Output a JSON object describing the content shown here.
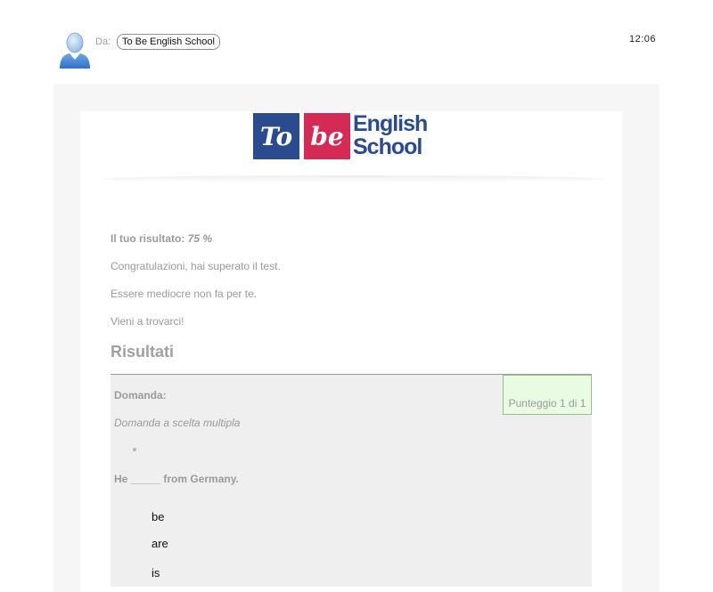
{
  "header": {
    "from_label": "Da:",
    "sender": "To Be English School",
    "time": "12:06",
    "avatar_icon": "user-avatar-icon"
  },
  "logo": {
    "box1": "To",
    "box2": "be",
    "line1": "English",
    "line2": "School",
    "colors": {
      "blue": "#2a4b8d",
      "pink": "#d42a55"
    }
  },
  "body": {
    "score_label": "Il tuo risultato:",
    "score_value": "75 %",
    "congrats": "Congratulazioni, hai superato il test.",
    "mediocre": "Essere mediocre non fa per te.",
    "visit": "Vieni a trovarci!",
    "results_title": "Risultati"
  },
  "question": {
    "label": "Domanda:",
    "type": "Domanda a scelta multipla",
    "text": "He _____ from Germany.",
    "points": "Punteggio 1 di 1",
    "answers": [
      "be",
      "are",
      "is"
    ]
  }
}
